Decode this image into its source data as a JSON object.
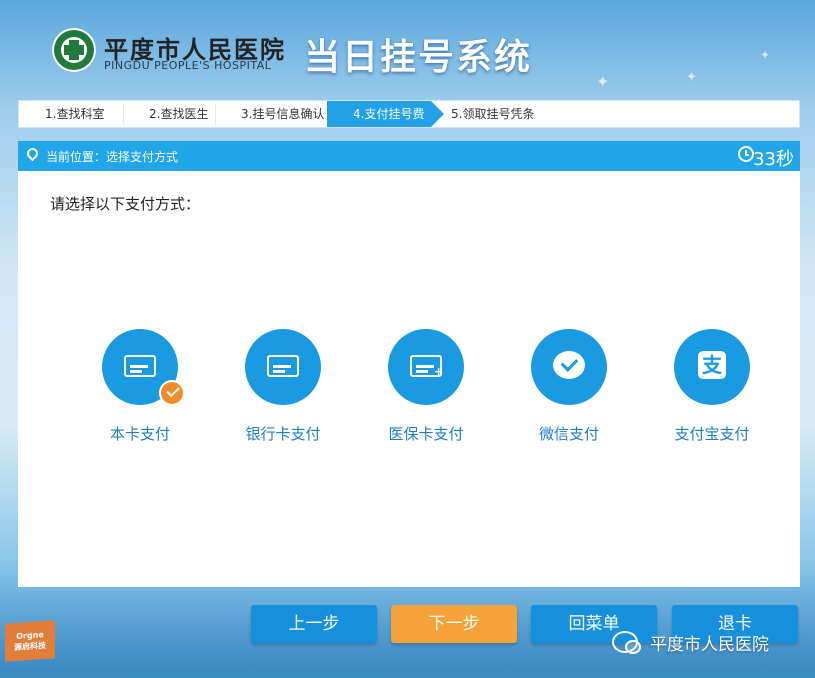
{
  "header": {
    "hospital_name_cn": "平度市人民医院",
    "hospital_name_en": "PINGDU PEOPLE'S HOSPITAL",
    "system_title": "当日挂号系统"
  },
  "steps": [
    {
      "label": "1.查找科室",
      "active": false
    },
    {
      "label": "2.查找医生",
      "active": false
    },
    {
      "label": "3.挂号信息确认",
      "active": false
    },
    {
      "label": "4.支付挂号费",
      "active": true
    },
    {
      "label": "5.领取挂号凭条",
      "active": false
    }
  ],
  "location": {
    "text": "当前位置：选择支付方式",
    "countdown": "33秒"
  },
  "main": {
    "prompt": "请选择以下支付方式：",
    "methods": [
      {
        "label": "本卡支付",
        "icon": "card-icon",
        "selected": true
      },
      {
        "label": "银行卡支付",
        "icon": "bank-card-icon",
        "selected": false
      },
      {
        "label": "医保卡支付",
        "icon": "medical-insurance-card-icon",
        "selected": false
      },
      {
        "label": "微信支付",
        "icon": "wechat-pay-icon",
        "selected": false
      },
      {
        "label": "支付宝支付",
        "icon": "alipay-icon",
        "selected": false
      }
    ]
  },
  "buttons": {
    "prev": "上一步",
    "next": "下一步",
    "menu": "回菜单",
    "exit": "退卡"
  },
  "badge": {
    "line1": "Orgne",
    "line2": "源启科技"
  },
  "watermark": "平度市人民医院",
  "colors": {
    "primary": "#22a6ea",
    "accent_orange": "#f5a23a",
    "selected_check": "#f08c2a",
    "method_label": "#1a7fc4"
  }
}
